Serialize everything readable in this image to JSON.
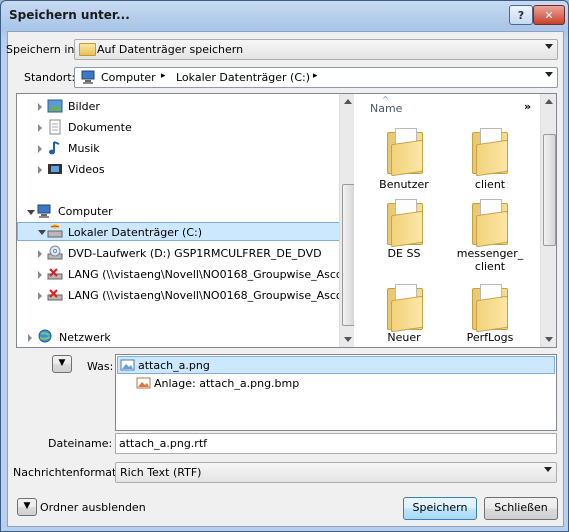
{
  "window": {
    "title": "Speichern unter...",
    "help_label": "?",
    "close_label": "✕"
  },
  "save_in": {
    "label": "Speichern in:",
    "value": "Auf Datenträger speichern"
  },
  "location": {
    "label": "Standort:",
    "crumbs": [
      "Computer",
      "Lokaler Datenträger (C:)"
    ]
  },
  "tree": {
    "libraries": [
      "Bilder",
      "Dokumente",
      "Musik",
      "Videos"
    ],
    "computer": "Computer",
    "drives": [
      "Lokaler Datenträger (C:)",
      "DVD-Laufwerk (D:) GSP1RMCULFRER_DE_DVD",
      "LANG (\\\\vistaeng\\Novell\\NO0168_Groupwise_Asco",
      "LANG (\\\\vistaeng\\Novell\\NO0168_Groupwise_Asco"
    ],
    "network": "Netzwerk"
  },
  "files": {
    "column_header": "Name",
    "more": "»",
    "items": [
      "Benutzer",
      "client",
      "DE SS",
      "messenger_client",
      "Neuer",
      "PerfLogs"
    ],
    "item_label_lines": [
      [
        "Benutzer"
      ],
      [
        "client"
      ],
      [
        "DE SS"
      ],
      [
        "messenger_",
        "client"
      ],
      [
        "Neuer"
      ],
      [
        "PerfLogs"
      ]
    ]
  },
  "was": {
    "label": "Was:",
    "items": [
      "attach_a.png",
      "Anlage: attach_a.png.bmp"
    ]
  },
  "filename": {
    "label": "Dateiname:",
    "value": "attach_a.png.rtf"
  },
  "format": {
    "label": "Nachrichtenformat:",
    "value": "Rich Text (RTF)"
  },
  "footer": {
    "hide_folders": "Ordner ausblenden",
    "save": "Speichern",
    "close": "Schließen"
  }
}
